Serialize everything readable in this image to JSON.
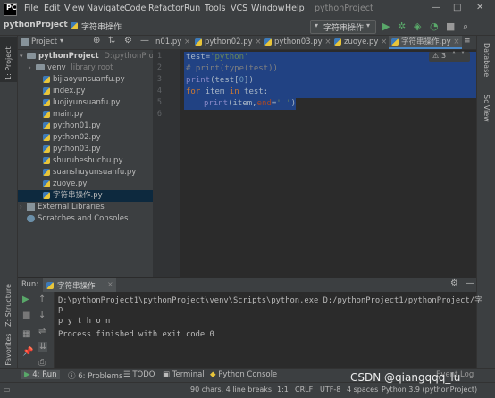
{
  "titlebar": {
    "menu": [
      "File",
      "Edit",
      "View",
      "Navigate",
      "Code",
      "Refactor",
      "Run",
      "Tools",
      "VCS",
      "Window",
      "Help"
    ],
    "app_title": "pythonProject"
  },
  "navbar": {
    "breadcrumb_project": "pythonProject",
    "breadcrumb_file": "字符串操作",
    "run_config": "字符串操作"
  },
  "left_stripe": {
    "project": "1: Project",
    "structure": "Z: Structure",
    "favorites": "2: Favorites"
  },
  "right_stripe": {
    "database": "Database",
    "sciview": "SciView"
  },
  "project_panel": {
    "title": "Project",
    "root_name": "pythonProject",
    "root_path": "D:\\pythonProject",
    "venv_name": "venv",
    "venv_note": "library root",
    "files": [
      "bijiaoyunsuanfu.py",
      "index.py",
      "luojiyunsuanfu.py",
      "main.py",
      "python01.py",
      "python02.py",
      "python03.py",
      "shuruheshuchu.py",
      "suanshuyunsuanfu.py",
      "zuoye.py",
      "字符串操作.py"
    ],
    "external_libraries": "External Libraries",
    "scratches": "Scratches and Consoles"
  },
  "editor_tabs": [
    "n01.py",
    "python02.py",
    "python03.py",
    "zuoye.py",
    "字符串操作.py"
  ],
  "inspection": "3",
  "code": {
    "line_numbers": [
      "1",
      "2",
      "3",
      "4",
      "5",
      "6"
    ],
    "l1_a": "test=",
    "l1_b": "'python'",
    "l2": "# print(type(test))",
    "l3_a": "print",
    "l3_b": "(test[",
    "l3_c": "0",
    "l3_d": "])",
    "l4_a": "for",
    "l4_b": " item ",
    "l4_c": "in",
    "l4_d": " test:",
    "l5_a": "print",
    "l5_b": "(item,",
    "l5_c": "end",
    "l5_d": "=",
    "l5_e": "' '",
    "l5_f": ")"
  },
  "run_panel": {
    "label": "Run:",
    "tab": "字符串操作",
    "console": [
      "D:\\pythonProject1\\pythonProject\\venv\\Scripts\\python.exe D:/pythonProject1/pythonProject/字",
      "p",
      "p y t h o n",
      "",
      "Process finished with exit code 0"
    ]
  },
  "bottom_tools": [
    "4: Run",
    "6: Problems",
    "TODO",
    "Terminal",
    "Python Console"
  ],
  "event_log": "Event Log",
  "status": {
    "chars": "90 chars, 4 line breaks",
    "pos": "1:1",
    "crlf": "CRLF",
    "enc": "UTF-8",
    "indent": "4 spaces",
    "interp": "Python 3.9 (pythonProject)"
  },
  "watermark": "CSDN @qiangqqq_lu",
  "colors": {
    "keyword": "#cc7832",
    "string": "#6a8759",
    "comment": "#808080",
    "number": "#6897bb",
    "selection": "#214283",
    "param": "#aa4926"
  }
}
